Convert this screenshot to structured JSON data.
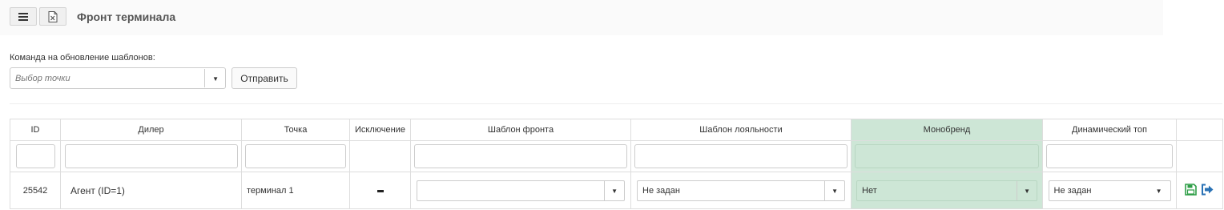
{
  "header": {
    "title": "Фронт терминала"
  },
  "toolbar": {
    "menu_icon": "menu-icon",
    "excel_icon": "excel-icon"
  },
  "command": {
    "label": "Команда на обновление шаблонов:",
    "point_placeholder": "Выбор точки",
    "send_label": "Отправить"
  },
  "table": {
    "columns": [
      "ID",
      "Дилер",
      "Точка",
      "Исключение",
      "Шаблон фронта",
      "Шаблон лояльности",
      "Монобренд",
      "Динамический топ"
    ],
    "highlight_color": "#cde6d6",
    "row": {
      "id": "25542",
      "dealer": "Агент (ID=1)",
      "point": "терминал 1",
      "front_template": "",
      "loyalty_template": "Не задан",
      "monobrand": "Нет",
      "dynamic_top": "Не задан"
    },
    "actions": [
      "save-icon",
      "login-icon"
    ]
  }
}
